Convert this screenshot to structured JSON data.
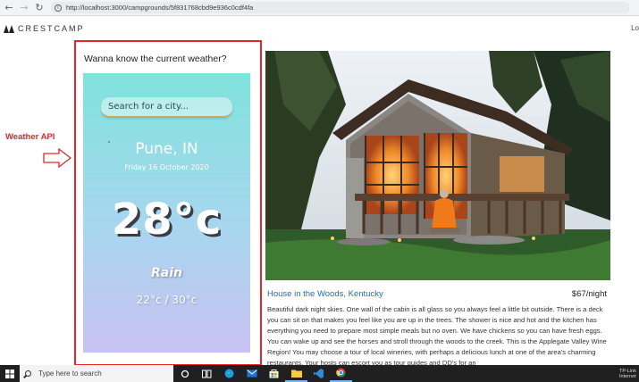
{
  "browser": {
    "back_icon": "back-arrow-icon",
    "forward_icon": "forward-arrow-icon",
    "reload_icon": "reload-icon",
    "url": "http://localhost:3000/campgrounds/5f831768cbd9e936c0cdf4fa"
  },
  "site": {
    "brand": "CRESTCAMP",
    "logo_icon": "tents-icon",
    "nav_right": "Lo"
  },
  "annotation": {
    "label": "Weather API",
    "arrow_icon": "right-arrow-icon",
    "color": "#e3262c"
  },
  "weather": {
    "heading": "Wanna know the current weather?",
    "search_placeholder": "Search for a city...",
    "city": "Pune, IN",
    "date": "Friday 16 October 2020",
    "temperature": "28°c",
    "condition": "Rain",
    "range": "22°c / 30°c",
    "gradient": [
      "#7fe3dc",
      "#a8d6ef",
      "#c9c2f2"
    ]
  },
  "campground": {
    "photo_alt": "cabin-photo",
    "title": "House in the Woods, Kentucky",
    "price": "$67/night",
    "description": "Beautiful dark night skies. One wall of the cabin is all glass so you always feel a little bit outside. There is a deck you can sit on that makes you feel like you are up in the trees. The shower is nice and hot and the kitchen has everything you need to prepare most simple meals but no oven. We have chickens so you can have fresh eggs. You can wake up and see the horses and stroll through the woods to the creek. This is the Applegate Valley Wine Region! You may choose a tour of local wineries, with perhaps a delicious lunch at one of the area's charming restaurants. Your hosts can escort you as tour guides and DD's for an",
    "link_color": "#1f6fb5"
  },
  "taskbar": {
    "search_placeholder": "Type here to search",
    "icons": [
      "windows-start-icon",
      "cortana-icon",
      "task-view-icon",
      "edge-icon",
      "mail-icon",
      "store-icon",
      "folder-icon",
      "vscode-icon",
      "chrome-icon"
    ],
    "tray_text": "TP-Link Internet"
  }
}
